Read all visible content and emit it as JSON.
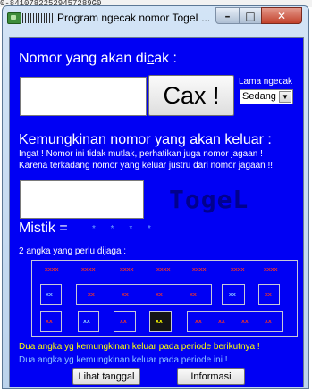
{
  "background_text": "0-84107822529457289G0",
  "window": {
    "title": "Program ngecak nomor TogeL...",
    "buttons": {
      "minimize": "–",
      "maximize": "□",
      "close": "✕"
    }
  },
  "form": {
    "header_prefix": "Nomor yang akan di",
    "header_underlined": "c",
    "header_suffix": "ak :",
    "input_value": "",
    "cax_button_label": "Cax !",
    "speed_label": "Lama ngecak",
    "speed_select_value": "Sedang",
    "possibility_header": "Kemungkinan nomor yang akan keluar :",
    "note_line1": "Ingat !  Nomor ini tidak mutlak, perhatikan juga nomor jagaan !",
    "note_line2": "Karena terkadang nomor yang keluar justru dari nomor jagaan !!",
    "result_value": "",
    "togel_label": "TogeL",
    "mistik_label": "Mistik =",
    "mistik_value": "* * * *",
    "guard_label": "2 angka yang perlu dijaga :"
  },
  "guard_panel": {
    "top_row": [
      "xxxx",
      "xxxx",
      "xxxx",
      "xxxx",
      "xxxx",
      "xxxx",
      "xxxx"
    ],
    "mid_row": {
      "left_cell": "xx",
      "wide_cell": [
        "xx",
        "xx",
        "xx",
        "xx"
      ],
      "right_cell1": "xx",
      "right_cell2": "xx"
    },
    "bottom_row": {
      "cell1": "xx",
      "cell2": "xx",
      "cell3": "xx",
      "cell4": "xx",
      "wide_cell": [
        "xx",
        "xx",
        "xx",
        "xx"
      ]
    }
  },
  "footer": {
    "info_line1": "Dua angka yg kemungkinan keluar pada periode berikutnya !",
    "info_line2": "Dua angka yg kemungkinan keluar pada periode ini !",
    "btn_lihat": "Lihat tanggal",
    "btn_info": "Informasi"
  },
  "colors": {
    "client_bg": "#0000f4",
    "red_mark": "#e53030",
    "blue_mark": "#8ec6ff",
    "yellow_mark": "#ffff00",
    "togel_text": "#00008e"
  }
}
